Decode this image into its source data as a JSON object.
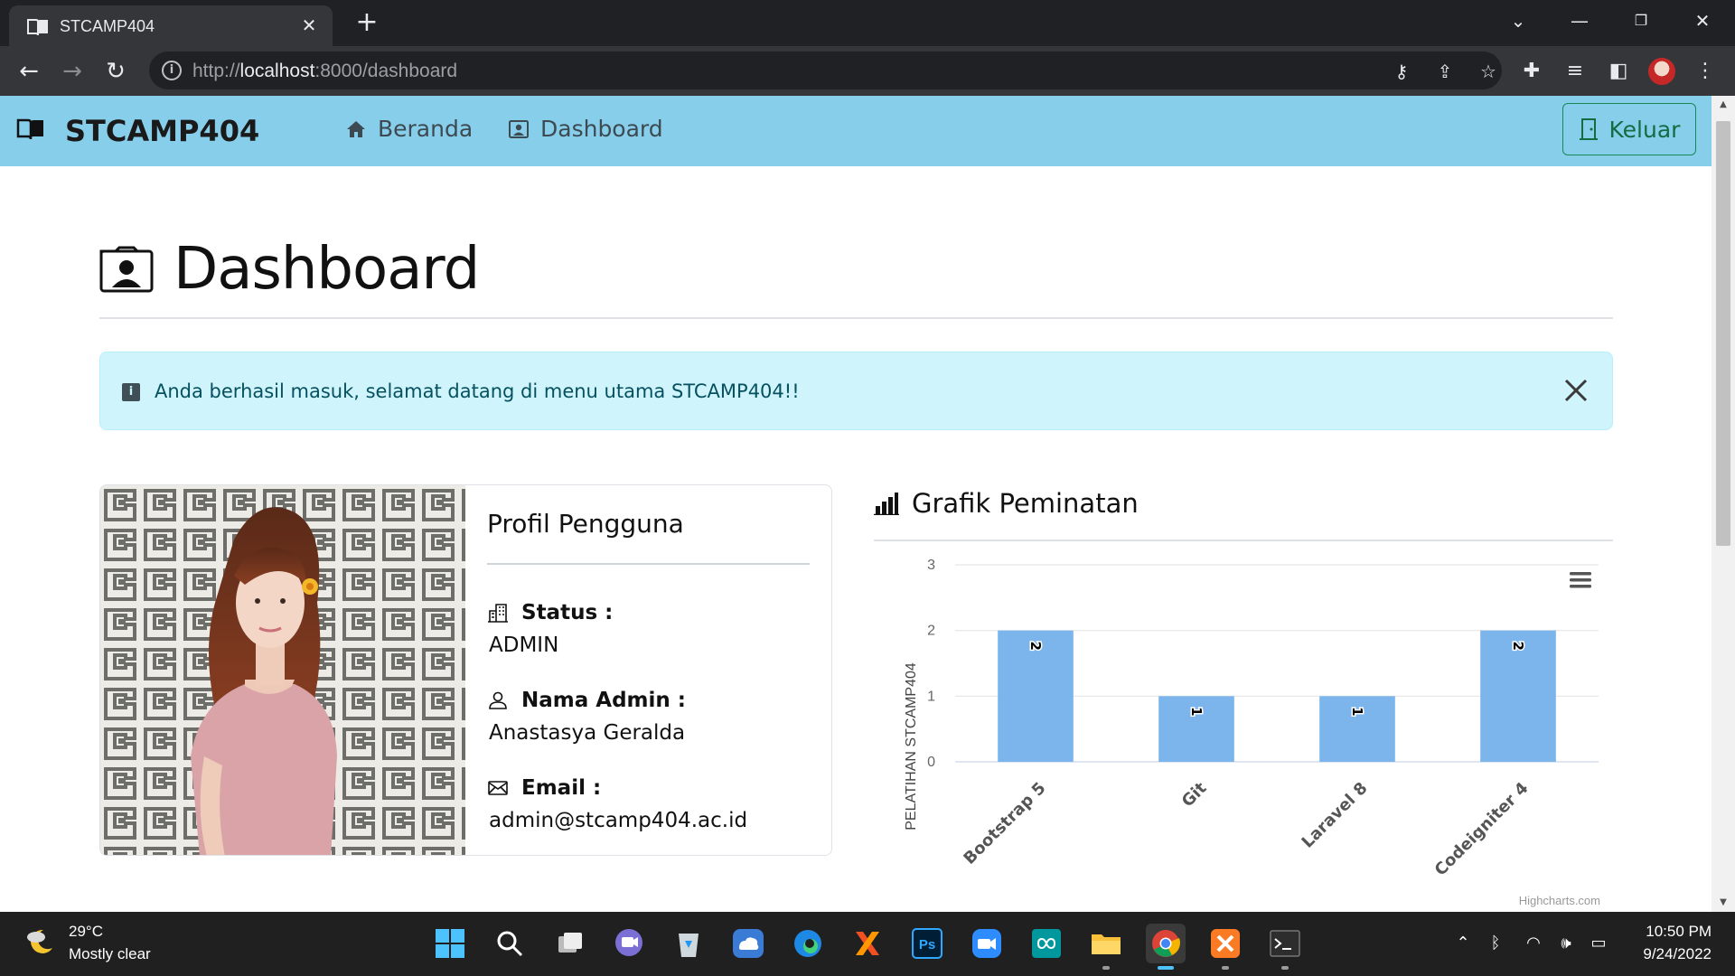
{
  "browser": {
    "tab_title": "STCAMP404",
    "new_tab_symbol": "+",
    "url_prefix": "http://",
    "url_host": "localhost",
    "url_rest": ":8000/dashboard"
  },
  "navbar": {
    "brand": "STCAMP404",
    "links": [
      {
        "label": "Beranda",
        "icon": "home-icon"
      },
      {
        "label": "Dashboard",
        "icon": "person-badge-icon"
      }
    ],
    "logout_label": "Keluar",
    "background": "#87ceeb"
  },
  "page": {
    "title": "Dashboard",
    "alert_text": "Anda berhasil masuk, selamat datang di menu utama STCAMP404!!",
    "alert_color": "#cff4fc"
  },
  "profile": {
    "title": "Profil Pengguna",
    "status_label": "Status :",
    "status_value": "ADMIN",
    "name_label": "Nama Admin :",
    "name_value": "Anastasya Geralda",
    "email_label": "Email :",
    "email_value": "admin@stcamp404.ac.id"
  },
  "chart_section": {
    "title": "Grafik Peminatan"
  },
  "chart_data": {
    "type": "bar",
    "categories": [
      "Bootstrap 5",
      "Git",
      "Laravel 8",
      "Codeigniter 4"
    ],
    "values": [
      2,
      1,
      1,
      2
    ],
    "ylabel": "PELATIHAN STCAMP404",
    "xlabel": "",
    "ylim": [
      0,
      3
    ],
    "yticks": [
      0,
      1,
      2,
      3
    ],
    "data_labels": true,
    "grid": true,
    "bar_color": "#7cb5ec",
    "credits": "Highcharts.com"
  },
  "taskbar": {
    "weather_temp": "29°C",
    "weather_desc": "Mostly clear",
    "time": "10:50 PM",
    "date": "9/24/2022"
  }
}
